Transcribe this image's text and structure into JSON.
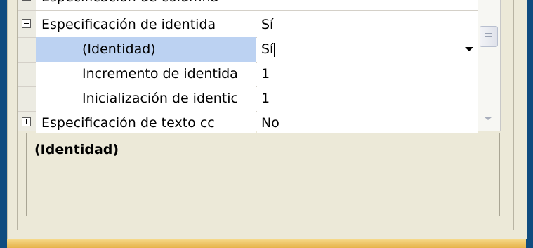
{
  "property_grid": {
    "rows": [
      {
        "name": "Especificación de columna",
        "value": "",
        "expander": "none"
      },
      {
        "name": "Especificación de identida",
        "value": "Sí",
        "expander": "minus"
      },
      {
        "name": "(Identidad)",
        "value": "Sí",
        "expander": "none",
        "selected": true
      },
      {
        "name": "Incremento de identida",
        "value": "1",
        "expander": "none"
      },
      {
        "name": "Inicialización de identic",
        "value": "1",
        "expander": "none"
      },
      {
        "name": "Especificación de texto cc",
        "value": "No",
        "expander": "plus"
      }
    ]
  },
  "description": {
    "title": "(Identidad)"
  },
  "colors": {
    "selected_row": "#bcd2f2",
    "window_frame": "#0f4c80",
    "dialog_bg": "#ece9d8"
  }
}
